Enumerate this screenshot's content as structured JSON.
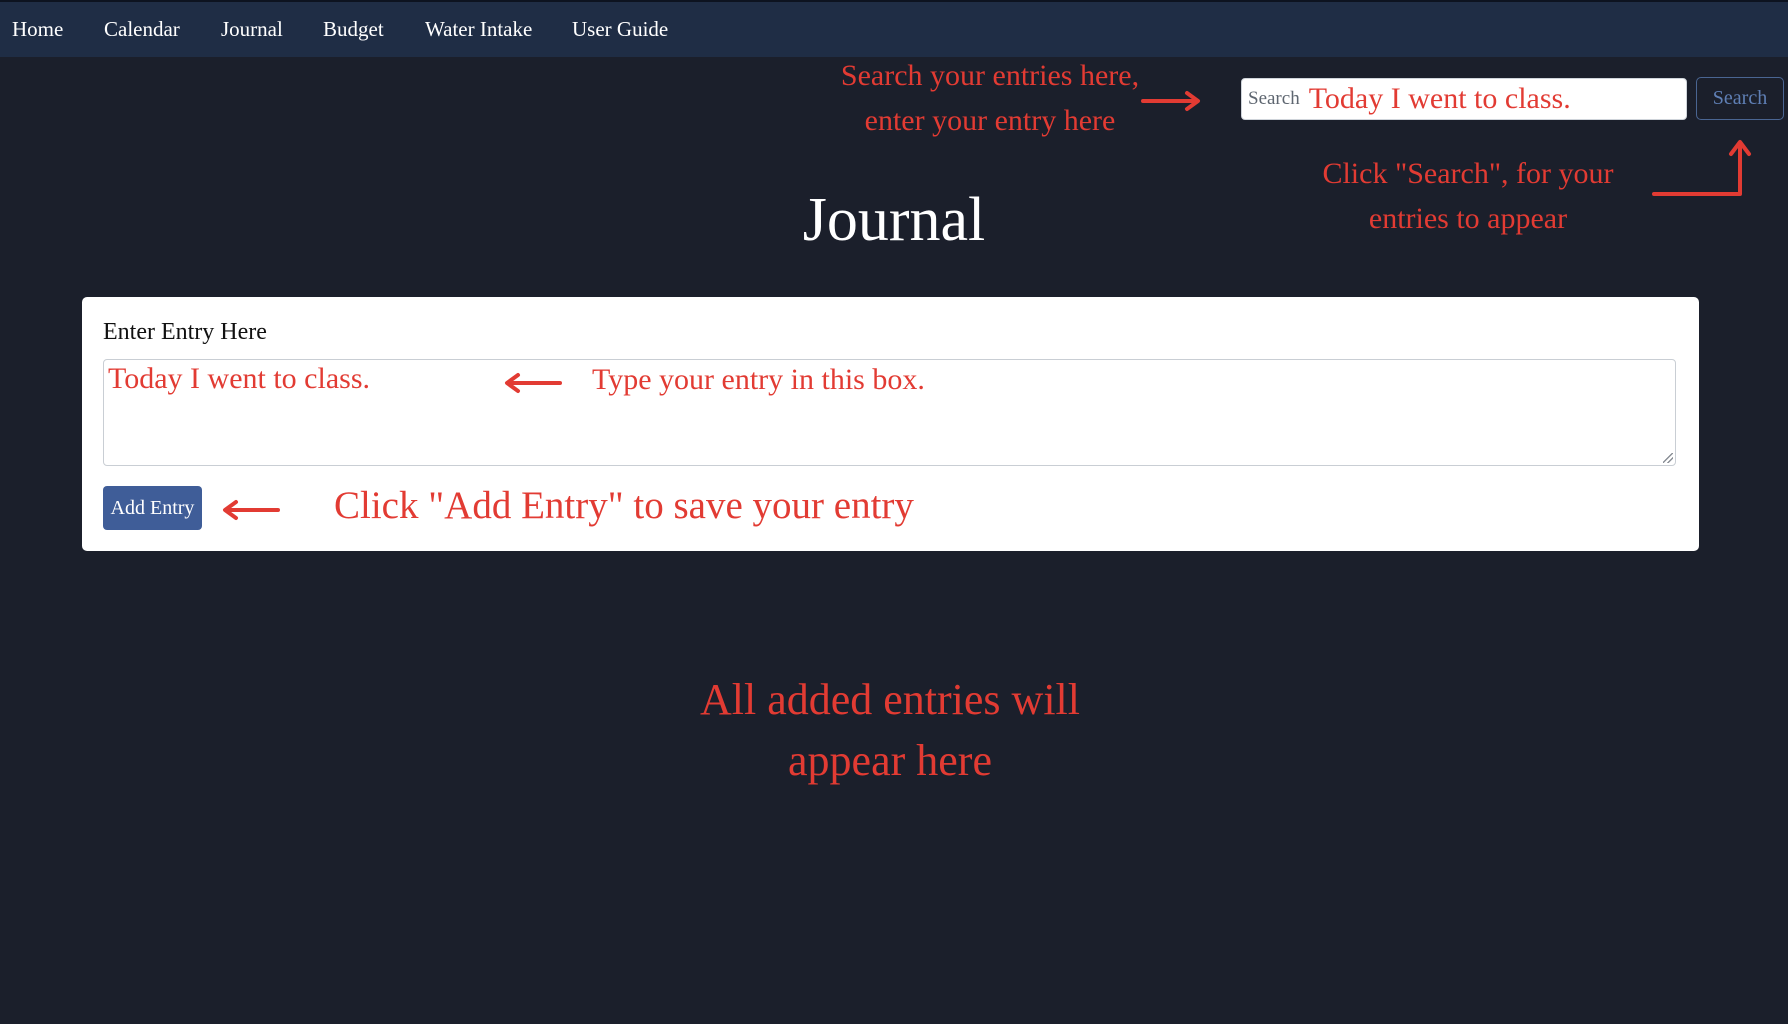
{
  "nav": {
    "items": [
      {
        "label": "Home"
      },
      {
        "label": "Calendar"
      },
      {
        "label": "Journal"
      },
      {
        "label": "Budget"
      },
      {
        "label": "Water Intake"
      },
      {
        "label": "User Guide"
      }
    ]
  },
  "search": {
    "placeholder": "Search",
    "value": "Today I went to class.",
    "button_label": "Search"
  },
  "page": {
    "title": "Journal"
  },
  "entry_form": {
    "label": "Enter Entry Here",
    "value": "Today I went to class.",
    "add_button_label": "Add Entry"
  },
  "annotations": {
    "search_hint_line1": "Search your entries here,",
    "search_hint_line2": "enter your entry here",
    "search_button_hint_line1": "Click \"Search\", for your",
    "search_button_hint_line2": "entries to appear",
    "textbox_hint": "Type your entry in this box.",
    "add_entry_hint": "Click \"Add Entry\" to save your entry",
    "entries_hint_line1": "All added entries will",
    "entries_hint_line2": "appear here"
  },
  "colors": {
    "background": "#1b1f2b",
    "navbar": "#1f2d45",
    "annotation": "#e23b33",
    "primary_button": "#3f5d98"
  },
  "icons": {
    "annotation_arrows": "arrow-icon"
  }
}
